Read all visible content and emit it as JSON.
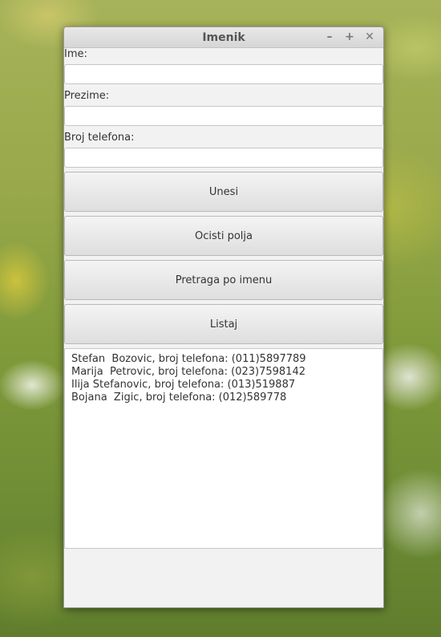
{
  "window": {
    "title": "Imenik"
  },
  "controls": {
    "minimize": "–",
    "maximize": "+",
    "close": "✕"
  },
  "form": {
    "first_name_label": "Ime:",
    "first_name_value": "",
    "last_name_label": "Prezime:",
    "last_name_value": "",
    "phone_label": "Broj telefona:",
    "phone_value": ""
  },
  "buttons": {
    "enter": "Unesi",
    "clear": "Ocisti polja",
    "search": "Pretraga po imenu",
    "list": "Listaj"
  },
  "contacts": [
    "Stefan  Bozovic, broj telefona: (011)5897789",
    "Marija  Petrovic, broj telefona: (023)7598142",
    "Ilija Stefanovic, broj telefona: (013)519887",
    "Bojana  Zigic, broj telefona: (012)589778"
  ]
}
